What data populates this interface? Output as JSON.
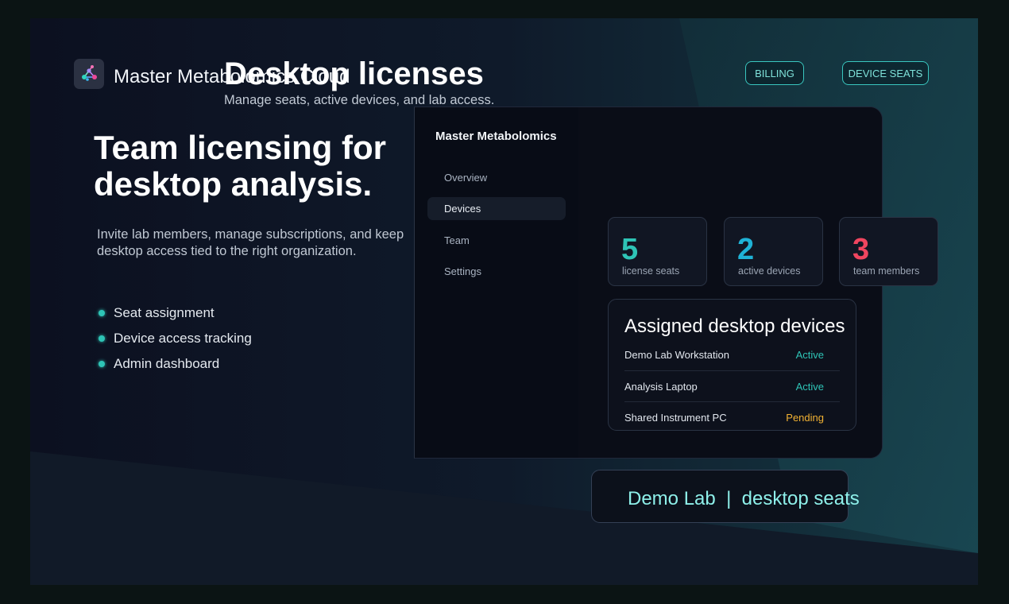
{
  "app": {
    "brand": "Master Metabolomics Cloud",
    "logo_icon": "network-molecule-icon"
  },
  "header": {
    "billing_label": "BILLING",
    "device_seats_label": "DEVICE SEATS"
  },
  "hero": {
    "title": "Team licensing for desktop analysis.",
    "subtitle": "Invite lab members, manage subscriptions, and keep desktop access tied to the right organization.",
    "features": [
      "Seat assignment",
      "Device access tracking",
      "Admin dashboard"
    ]
  },
  "panel": {
    "sidebar": {
      "brand": "Master Metabolomics",
      "items": [
        {
          "label": "Overview",
          "active": false
        },
        {
          "label": "Devices",
          "active": true
        },
        {
          "label": "Team",
          "active": false
        },
        {
          "label": "Settings",
          "active": false
        }
      ]
    },
    "main": {
      "title": "Desktop licenses",
      "subtitle": "Manage seats, active devices, and lab access.",
      "stats": [
        {
          "value": "5",
          "label": "license seats",
          "color": "#2ec4b6"
        },
        {
          "value": "2",
          "label": "active devices",
          "color": "#1fb2d6"
        },
        {
          "value": "3",
          "label": "team members",
          "color": "#f0455f"
        }
      ],
      "devices": {
        "title": "Assigned desktop devices",
        "rows": [
          {
            "name": "Demo Lab Workstation",
            "status": "Active",
            "status_color": "#2ec4b6"
          },
          {
            "name": "Analysis Laptop",
            "status": "Active",
            "status_color": "#2ec4b6"
          },
          {
            "name": "Shared Instrument PC",
            "status": "Pending",
            "status_color": "#f2b233"
          }
        ]
      }
    }
  },
  "footer": {
    "org": "Demo Lab",
    "separator": "|",
    "seats_label": "desktop seats"
  },
  "colors": {
    "accent": "#2ec4b6",
    "pending": "#f2b233",
    "danger": "#f0455f"
  }
}
